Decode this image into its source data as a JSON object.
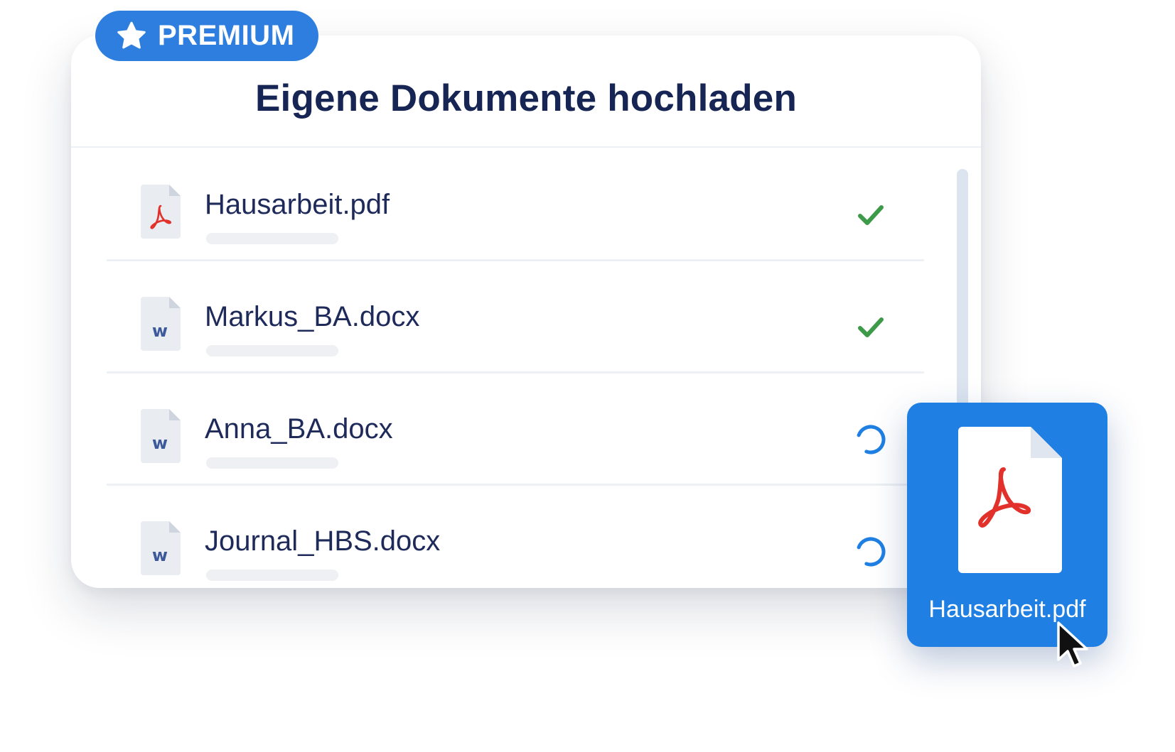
{
  "badge": {
    "label": "PREMIUM",
    "icon": "star-icon"
  },
  "title": "Eigene Dokumente hochladen",
  "files": [
    {
      "name": "Hausarbeit.pdf",
      "type": "pdf",
      "status": "done"
    },
    {
      "name": "Markus_BA.docx",
      "type": "docx",
      "status": "done"
    },
    {
      "name": "Anna_BA.docx",
      "type": "docx",
      "status": "uploading"
    },
    {
      "name": "Journal_HBS.docx",
      "type": "docx",
      "status": "uploading"
    }
  ],
  "drag": {
    "file_name": "Hausarbeit.pdf",
    "icon": "pdf-document-icon"
  },
  "colors": {
    "accent": "#1f7fe3",
    "title": "#172554",
    "success": "#3c9a48",
    "pdf": "#e2302a",
    "word": "#3c5a9a"
  }
}
